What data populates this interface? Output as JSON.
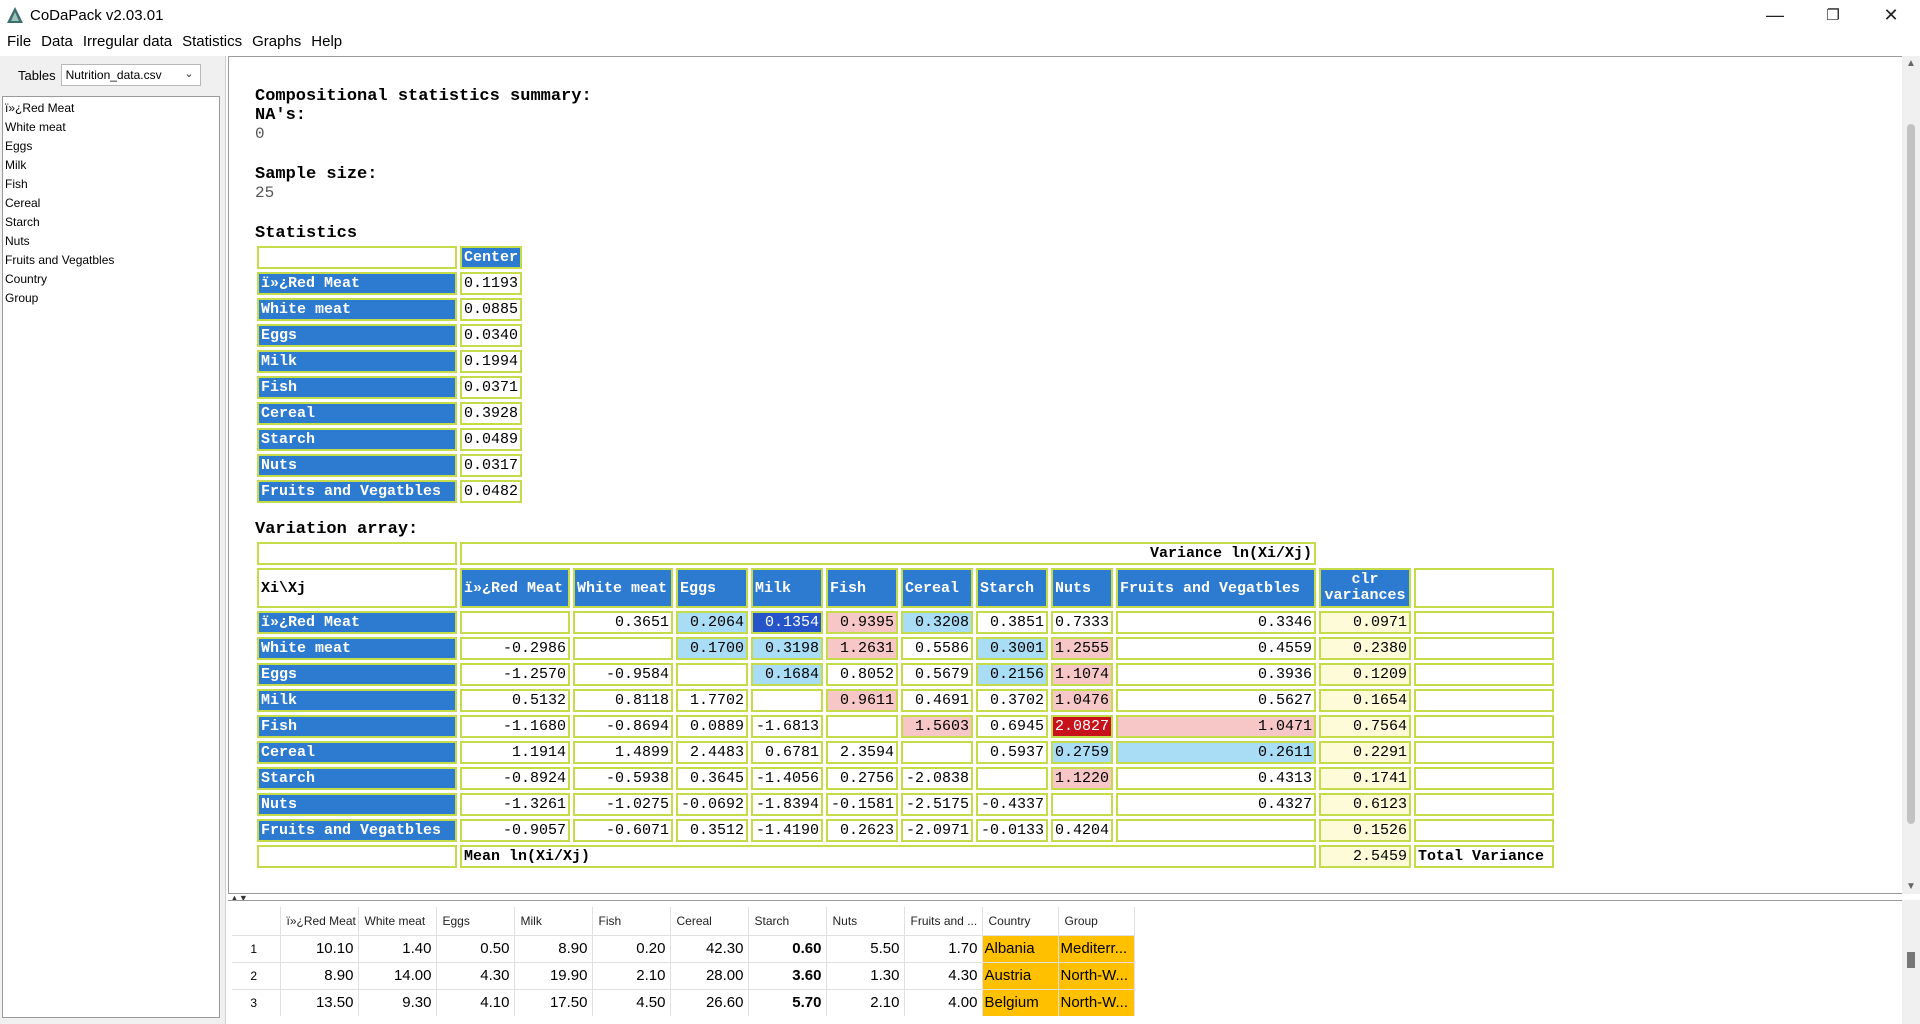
{
  "window": {
    "title": "CoDaPack v2.03.01"
  },
  "menu": [
    "File",
    "Data",
    "Irregular data",
    "Statistics",
    "Graphs",
    "Help"
  ],
  "left": {
    "tables_label": "Tables",
    "selected_table": "Nutrition_data.csv",
    "variables": [
      "ï»¿Red Meat",
      "White meat",
      "Eggs",
      "Milk",
      "Fish",
      "Cereal",
      "Starch",
      "Nuts",
      "Fruits and Vegatbles",
      "Country",
      "Group"
    ]
  },
  "output": {
    "summary_title": "Compositional statistics summary:",
    "na_label": "NA's:",
    "na_value": "0",
    "sample_label": "Sample size:",
    "sample_value": "25",
    "statistics_title": "Statistics",
    "center_header": "Center",
    "center_rows": [
      {
        "name": "ï»¿Red Meat",
        "value": "0.1193"
      },
      {
        "name": "White meat",
        "value": "0.0885"
      },
      {
        "name": "Eggs",
        "value": "0.0340"
      },
      {
        "name": "Milk",
        "value": "0.1994"
      },
      {
        "name": "Fish",
        "value": "0.0371"
      },
      {
        "name": "Cereal",
        "value": "0.3928"
      },
      {
        "name": "Starch",
        "value": "0.0489"
      },
      {
        "name": "Nuts",
        "value": "0.0317"
      },
      {
        "name": "Fruits and Vegatbles",
        "value": "0.0482"
      }
    ],
    "variation_title": "Variation array:",
    "variance_header": "Variance ln(Xi/Xj)",
    "corner_label": "Xi\\Xj",
    "columns": [
      "ï»¿Red Meat",
      "White meat",
      "Eggs",
      "Milk",
      "Fish",
      "Cereal",
      "Starch",
      "Nuts",
      "Fruits and Vegatbles"
    ],
    "clr_header": "clr variances",
    "rows": [
      {
        "name": "ï»¿Red Meat",
        "cells": [
          "",
          "0.3651",
          "0.2064",
          "0.1354",
          "0.9395",
          "0.3208",
          "0.3851",
          "0.7333",
          "0.3346"
        ],
        "clr": "0.0971"
      },
      {
        "name": "White meat",
        "cells": [
          "-0.2986",
          "",
          "0.1700",
          "0.3198",
          "1.2631",
          "0.5586",
          "0.3001",
          "1.2555",
          "0.4559"
        ],
        "clr": "0.2380"
      },
      {
        "name": "Eggs",
        "cells": [
          "-1.2570",
          "-0.9584",
          "",
          "0.1684",
          "0.8052",
          "0.5679",
          "0.2156",
          "1.1074",
          "0.3936"
        ],
        "clr": "0.1209"
      },
      {
        "name": "Milk",
        "cells": [
          "0.5132",
          "0.8118",
          "1.7702",
          "",
          "0.9611",
          "0.4691",
          "0.3702",
          "1.0476",
          "0.5627"
        ],
        "clr": "0.1654"
      },
      {
        "name": "Fish",
        "cells": [
          "-1.1680",
          "-0.8694",
          "0.0889",
          "-1.6813",
          "",
          "1.5603",
          "0.6945",
          "2.0827",
          "1.0471"
        ],
        "clr": "0.7564"
      },
      {
        "name": "Cereal",
        "cells": [
          "1.1914",
          "1.4899",
          "2.4483",
          "0.6781",
          "2.3594",
          "",
          "0.5937",
          "0.2759",
          "0.2611"
        ],
        "clr": "0.2291"
      },
      {
        "name": "Starch",
        "cells": [
          "-0.8924",
          "-0.5938",
          "0.3645",
          "-1.4056",
          "0.2756",
          "-2.0838",
          "",
          "1.1220",
          "0.4313"
        ],
        "clr": "0.1741"
      },
      {
        "name": "Nuts",
        "cells": [
          "-1.3261",
          "-1.0275",
          "-0.0692",
          "-1.8394",
          "-0.1581",
          "-2.5175",
          "-0.4337",
          "",
          "0.4327"
        ],
        "clr": "0.6123"
      },
      {
        "name": "Fruits and Vegatbles",
        "cells": [
          "-0.9057",
          "-0.6071",
          "0.3512",
          "-1.4190",
          "0.2623",
          "-2.0971",
          "-0.0133",
          "0.4204",
          ""
        ],
        "clr": "0.1526"
      }
    ],
    "mean_label": "Mean ln(Xi/Xj)",
    "total_variance_value": "2.5459",
    "total_variance_label": "Total Variance"
  },
  "grid": {
    "headers": [
      "ï»¿Red Meat",
      "White meat",
      "Eggs",
      "Milk",
      "Fish",
      "Cereal",
      "Starch",
      "Nuts",
      "Fruits and ...",
      "Country",
      "Group"
    ],
    "rows": [
      [
        "1",
        "10.10",
        "1.40",
        "0.50",
        "8.90",
        "0.20",
        "42.30",
        "0.60",
        "5.50",
        "1.70",
        "Albania",
        "Mediterr..."
      ],
      [
        "2",
        "8.90",
        "14.00",
        "4.30",
        "19.90",
        "2.10",
        "28.00",
        "3.60",
        "1.30",
        "4.30",
        "Austria",
        "North-W..."
      ],
      [
        "3",
        "13.50",
        "9.30",
        "4.10",
        "17.50",
        "4.50",
        "26.60",
        "5.70",
        "2.10",
        "4.00",
        "Belgium",
        "North-W..."
      ]
    ]
  }
}
